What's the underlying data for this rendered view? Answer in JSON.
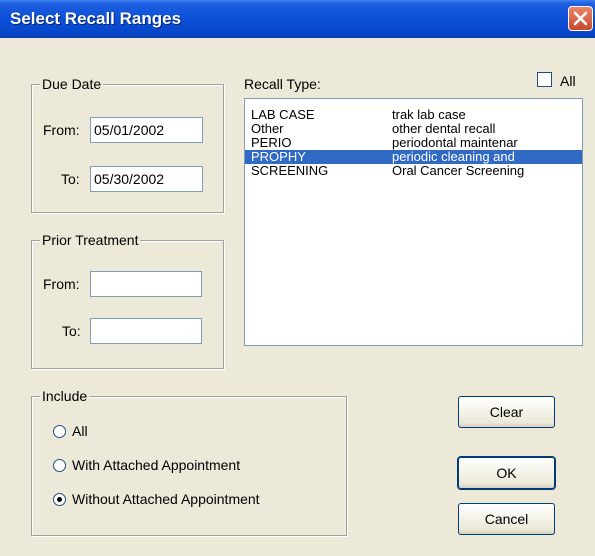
{
  "window": {
    "title": "Select Recall Ranges"
  },
  "due_date": {
    "legend": "Due Date",
    "from_label": "From:",
    "from_value": "05/01/2002",
    "to_label": "To:",
    "to_value": "05/30/2002"
  },
  "prior_treatment": {
    "legend": "Prior Treatment",
    "from_label": "From:",
    "from_value": "",
    "to_label": "To:",
    "to_value": ""
  },
  "recall_type": {
    "label": "Recall Type:",
    "all_label": "All",
    "all_checked": false,
    "items": [
      {
        "code": "LAB CASE",
        "description": "trak lab case",
        "selected": false
      },
      {
        "code": "Other",
        "description": "other dental recall",
        "selected": false
      },
      {
        "code": "PERIO",
        "description": "periodontal maintenar",
        "selected": false
      },
      {
        "code": "PROPHY",
        "description": "periodic cleaning and",
        "selected": true
      },
      {
        "code": "SCREENING",
        "description": "Oral Cancer Screening",
        "selected": false
      }
    ]
  },
  "include": {
    "legend": "Include",
    "options": [
      {
        "label": "All",
        "selected": false
      },
      {
        "label": "With Attached Appointment",
        "selected": false
      },
      {
        "label": "Without Attached Appointment",
        "selected": true
      }
    ]
  },
  "buttons": {
    "clear": "Clear",
    "ok": "OK",
    "cancel": "Cancel"
  },
  "colors": {
    "titlebar": "#0a4fd8",
    "selection": "#316ac5",
    "dialog_bg": "#ece9d8"
  }
}
